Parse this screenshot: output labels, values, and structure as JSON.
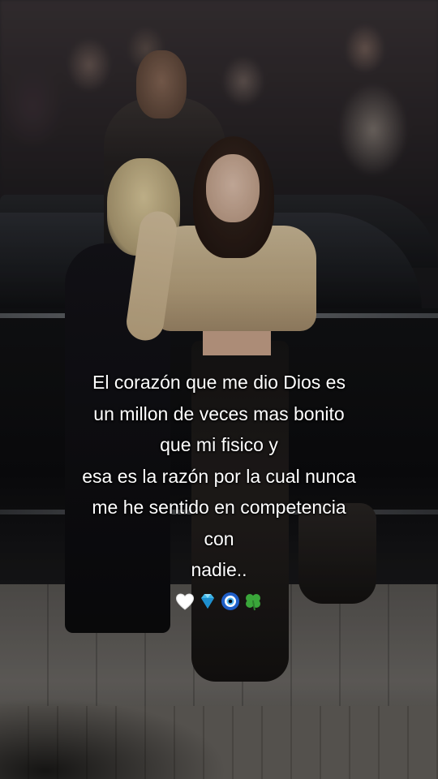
{
  "caption": {
    "lines": [
      "El corazón que me dio Dios es",
      "un millon de veces mas bonito",
      "que mi fisico y",
      "esa es la razón por la cual nunca",
      "me he sentido en competencia",
      "con",
      "nadie.."
    ],
    "emojis": [
      "white-heart-icon",
      "gem-icon",
      "nazar-amulet-icon",
      "four-leaf-clover-icon"
    ]
  },
  "colors": {
    "caption_text": "#ffffff",
    "heart": "#ffffff",
    "gem": "#3fb6e8",
    "nazar_outer": "#1f5fc8",
    "clover": "#3aa63a"
  }
}
